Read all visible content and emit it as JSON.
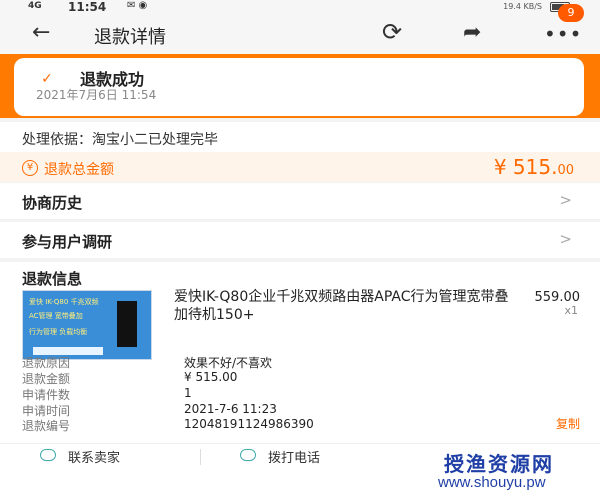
{
  "statusbar": {
    "signal": "4G",
    "time": "11:54",
    "net": "19.4 KB/S"
  },
  "navbar": {
    "title": "退款详情",
    "badge": "9"
  },
  "status": {
    "title": "退款成功",
    "time": "2021年7月6日 11:54"
  },
  "basis": {
    "text": "处理依据：淘宝小二已处理完毕"
  },
  "amount": {
    "label": "退款总金额",
    "value": "¥ 515.",
    "decimal": "00"
  },
  "rows": {
    "history": "协商历史",
    "survey": "参与用户调研"
  },
  "refund": {
    "section_title": "退款信息",
    "product_name": "爱快IK-Q80企业千兆双频路由器APAC行为管理宽带叠加待机150+",
    "product_price": "559.00",
    "product_qty": "x1",
    "thumb_texts": [
      "爱快 IK-Q80 千兆双频",
      "AC管理 宽带叠加",
      "行为管理 负载均衡"
    ],
    "fields": [
      {
        "label": "退款原因",
        "value": "效果不好/不喜欢"
      },
      {
        "label": "退款金额",
        "value": "¥ 515.00"
      },
      {
        "label": "申请件数",
        "value": "1"
      },
      {
        "label": "申请时间",
        "value": "2021-7-6 11:23"
      },
      {
        "label": "退款编号",
        "value": "1204819112498639​0"
      }
    ],
    "copy": "复制"
  },
  "bottom": {
    "contact_seller": "联系卖家",
    "call": "拨打电话"
  },
  "watermark": {
    "cn": "授渔资源网",
    "en": "www.shouyu.pw"
  },
  "colors": {
    "accent": "#ff6a00",
    "header_band": "#ff7a00"
  }
}
